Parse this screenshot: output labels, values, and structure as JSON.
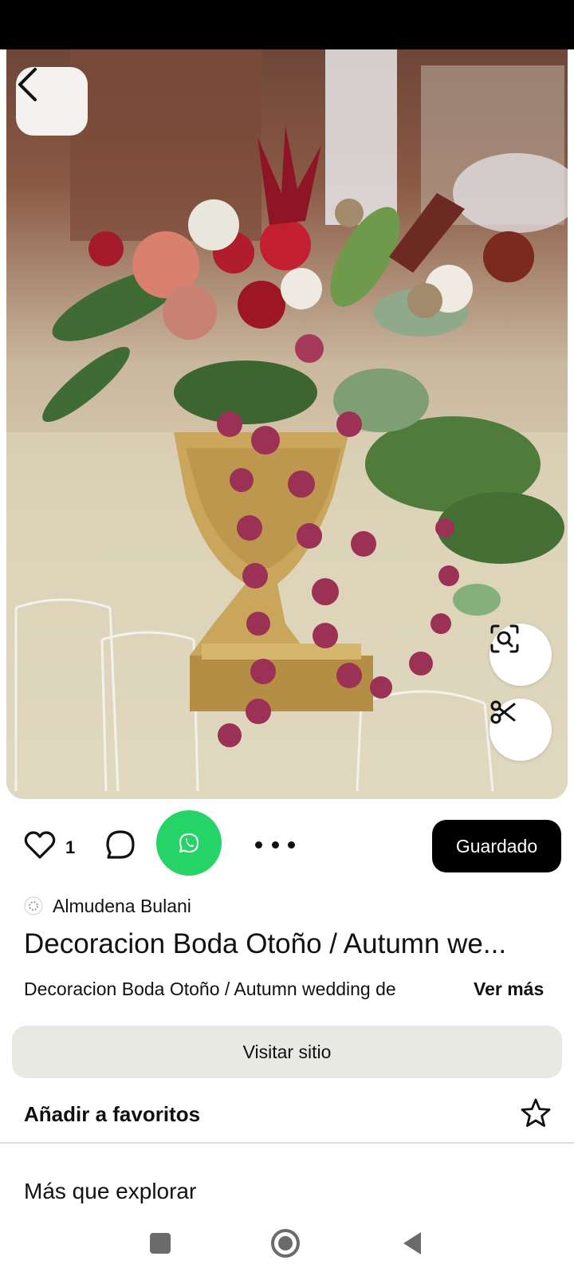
{
  "pin": {
    "image_icon": "flower-centerpiece-photo",
    "like_count": "1",
    "save_label": "Guardado",
    "author_name": "Almudena Bulani",
    "title": "Decoracion Boda Otoño / Autumn we...",
    "description": "Decoracion Boda Otoño / Autumn wedding de",
    "see_more_label": "Ver más"
  },
  "actions": {
    "visit_label": "Visitar sitio",
    "favorites_label": "Añadir a favoritos"
  },
  "explore": {
    "title": "Más que explorar"
  },
  "colors": {
    "save_bg": "#000000",
    "whatsapp": "#25d366",
    "visit_bg": "#e9e9e4"
  }
}
